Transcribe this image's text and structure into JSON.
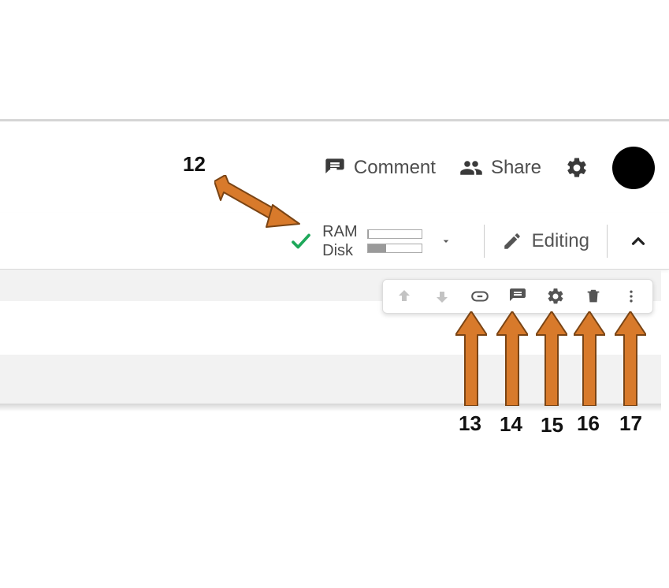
{
  "header": {
    "comment_label": "Comment",
    "share_label": "Share"
  },
  "status": {
    "ram_label": "RAM",
    "disk_label": "Disk",
    "ram_fill_percent": 2,
    "disk_fill_percent": 35
  },
  "editing": {
    "mode_label": "Editing"
  },
  "cell_toolbar": {
    "move_up": "move-cell-up",
    "move_down": "move-cell-down",
    "link": "copy-link",
    "comment": "add-comment",
    "settings": "cell-settings",
    "delete": "delete-cell",
    "more": "more-options"
  },
  "annotations": {
    "n12": "12",
    "n13": "13",
    "n14": "14",
    "n15": "15",
    "n16": "16",
    "n17": "17"
  },
  "colors": {
    "arrow_fill": "#d87a2b",
    "arrow_stroke": "#7a4414",
    "check": "#1ea85a"
  }
}
